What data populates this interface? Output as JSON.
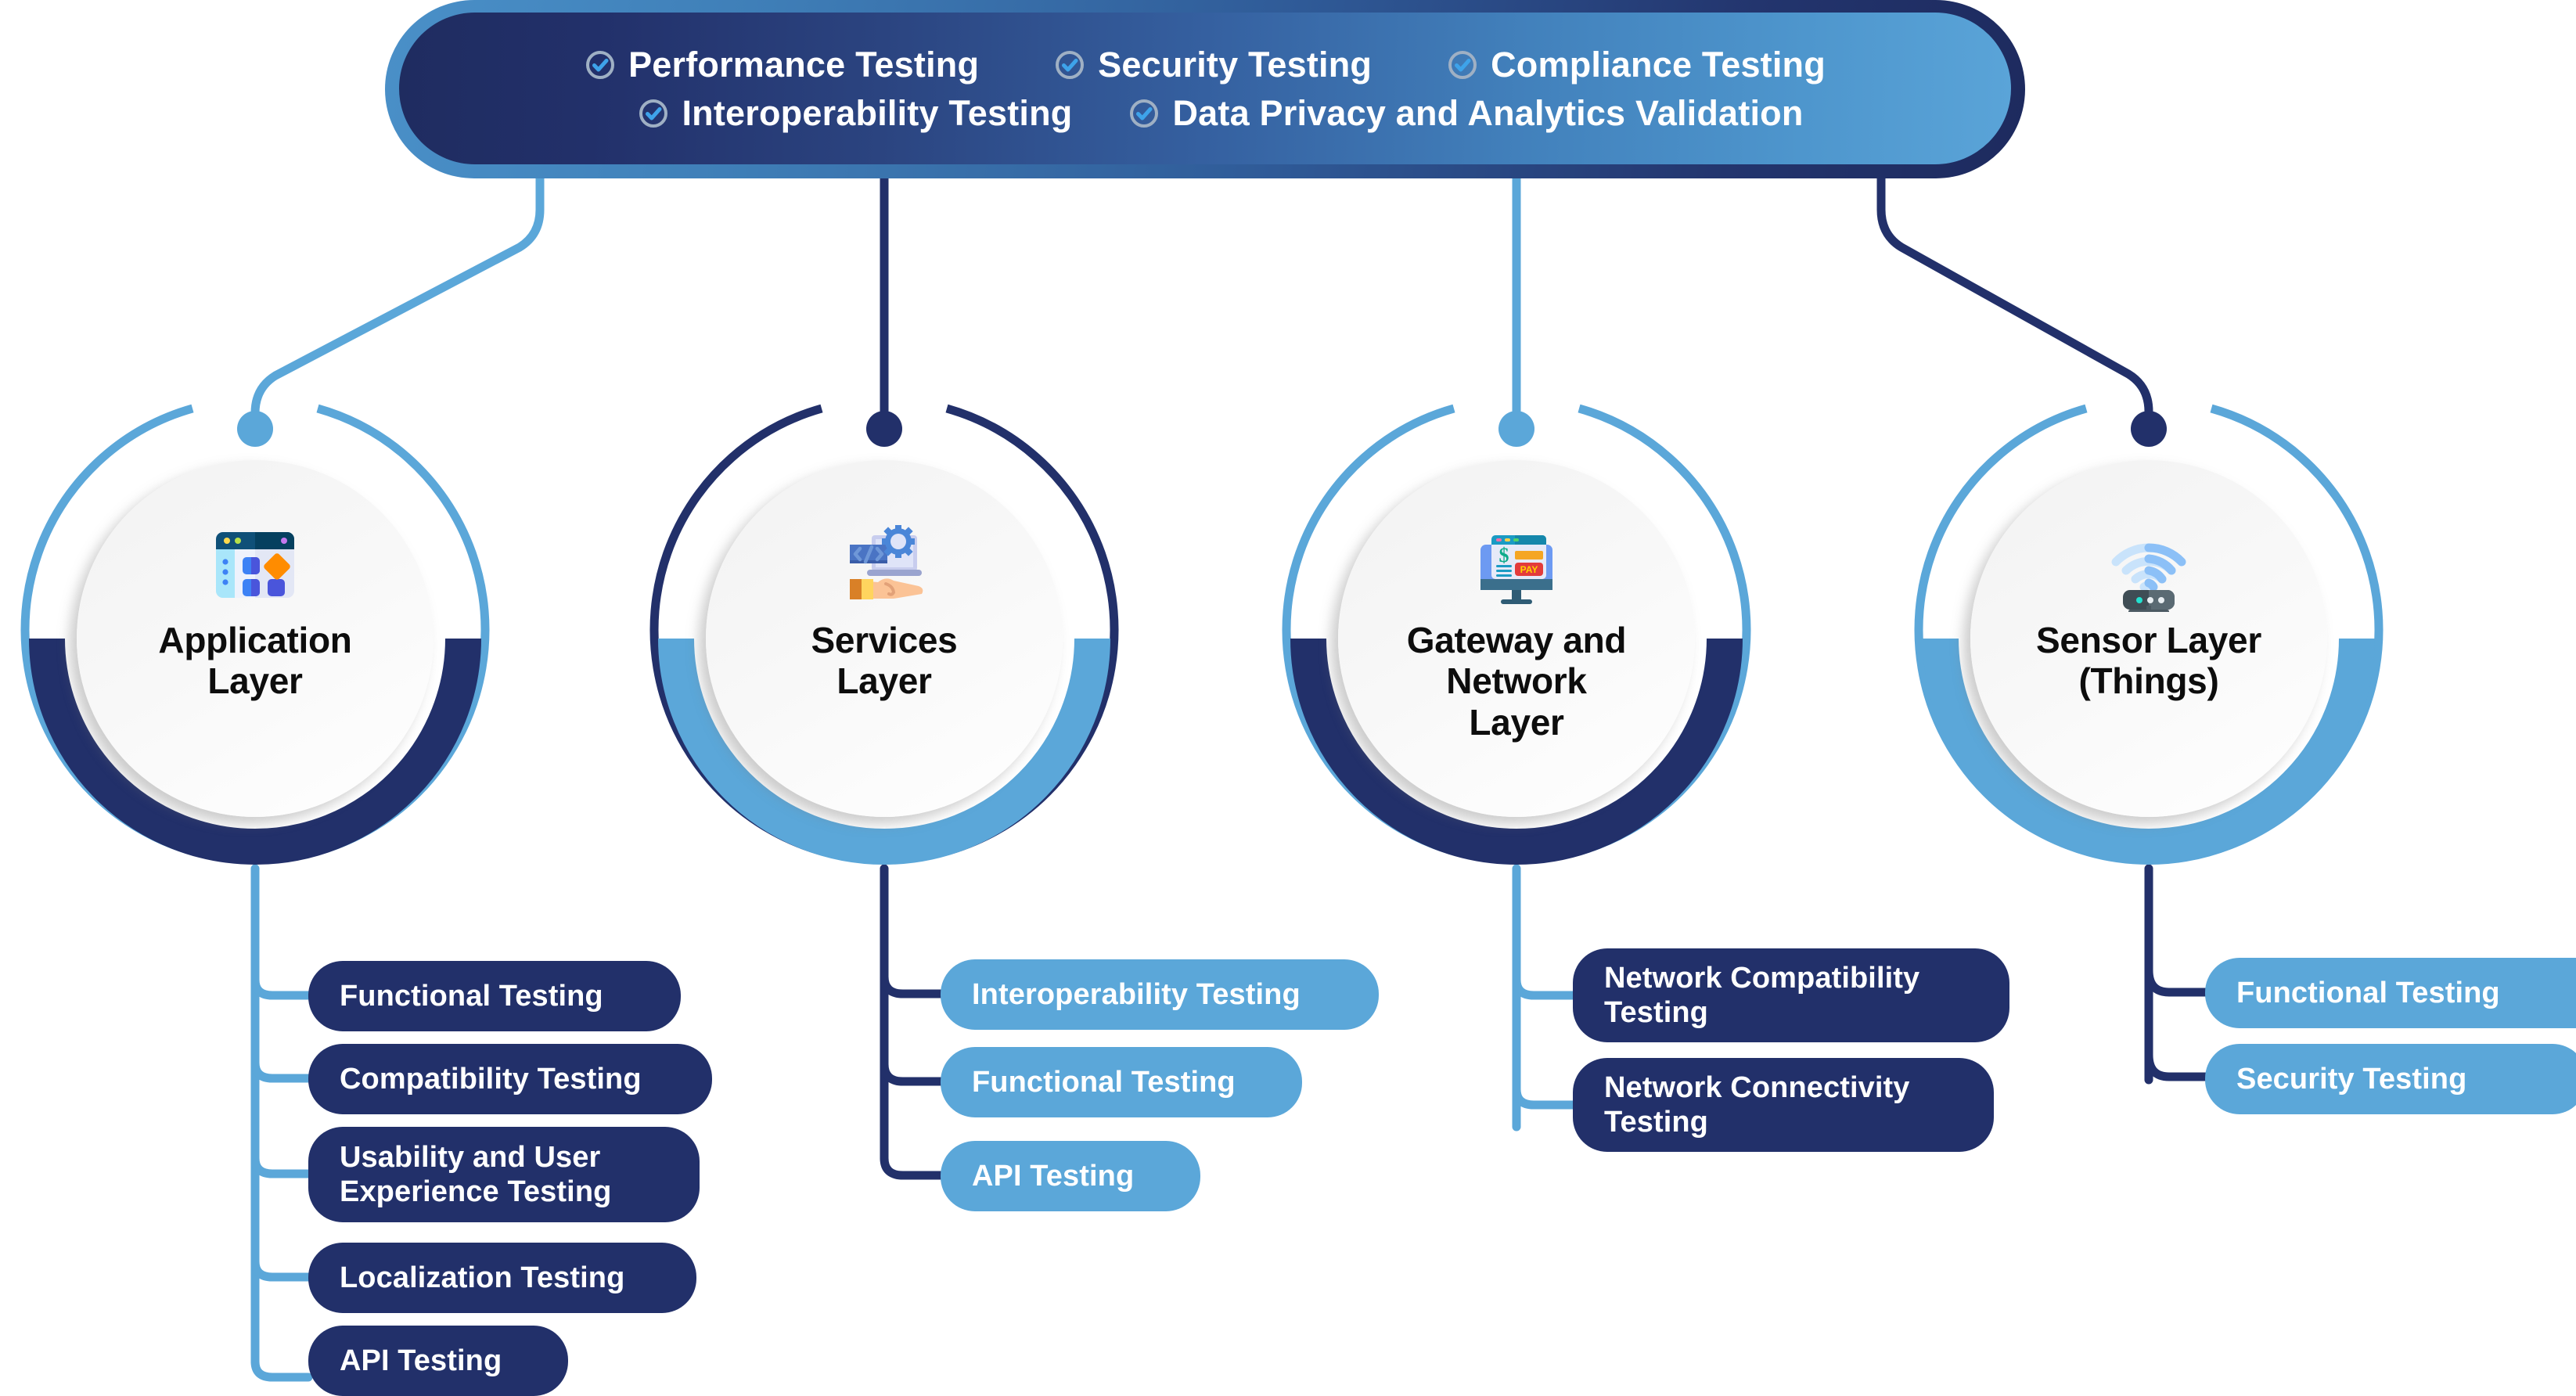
{
  "banner": {
    "icon": "check-circle-icon",
    "row1": [
      {
        "label": "Performance Testing"
      },
      {
        "label": "Security Testing"
      },
      {
        "label": "Compliance Testing"
      }
    ],
    "row2": [
      {
        "label": "Interoperability Testing"
      },
      {
        "label": "Data Privacy and Analytics Validation"
      }
    ]
  },
  "colors": {
    "navy": "#22306a",
    "light_blue": "#5ba7d9",
    "banner_gradient_start": "#1f2c60",
    "banner_gradient_end": "#5aa4d8",
    "disc": "#f7f7f7",
    "text_dark": "#0d0d0d",
    "text_light": "#ffffff"
  },
  "nodes": [
    {
      "title": "Application\nLayer",
      "icon": "application-window-icon",
      "outer_ring_color": "#5ba7d9",
      "inner_ring_color": "#22306a",
      "connector_color": "#5ba7d9"
    },
    {
      "title": "Services\nLayer",
      "icon": "laptop-gear-hand-icon",
      "outer_ring_color": "#22306a",
      "inner_ring_color": "#5ba7d9",
      "connector_color": "#22306a"
    },
    {
      "title": "Gateway and\nNetwork\nLayer",
      "icon": "payment-monitor-icon",
      "outer_ring_color": "#5ba7d9",
      "inner_ring_color": "#22306a",
      "connector_color": "#5ba7d9"
    },
    {
      "title": "Sensor Layer\n(Things)",
      "icon": "wifi-router-icon",
      "outer_ring_color": "#5ba7d9",
      "inner_ring_color": "#5ba7d9",
      "connector_color": "#22306a"
    }
  ],
  "columns": [
    {
      "node": "Application Layer",
      "pill_style": "navy",
      "connector_color": "#5ba7d9",
      "items": [
        {
          "label": "Functional Testing"
        },
        {
          "label": "Compatibility Testing"
        },
        {
          "label": "Usability and User\nExperience Testing"
        },
        {
          "label": "Localization Testing"
        },
        {
          "label": "API Testing"
        }
      ]
    },
    {
      "node": "Services Layer",
      "pill_style": "blue",
      "connector_color": "#22306a",
      "items": [
        {
          "label": "Interoperability Testing"
        },
        {
          "label": "Functional Testing"
        },
        {
          "label": "API Testing"
        }
      ]
    },
    {
      "node": "Gateway and Network Layer",
      "pill_style": "navy",
      "connector_color": "#5ba7d9",
      "items": [
        {
          "label": "Network Compatibility\nTesting"
        },
        {
          "label": "Network Connectivity\nTesting"
        }
      ]
    },
    {
      "node": "Sensor Layer (Things)",
      "pill_style": "blue",
      "connector_color": "#22306a",
      "items": [
        {
          "label": "Functional Testing"
        },
        {
          "label": "Security Testing"
        }
      ]
    }
  ]
}
